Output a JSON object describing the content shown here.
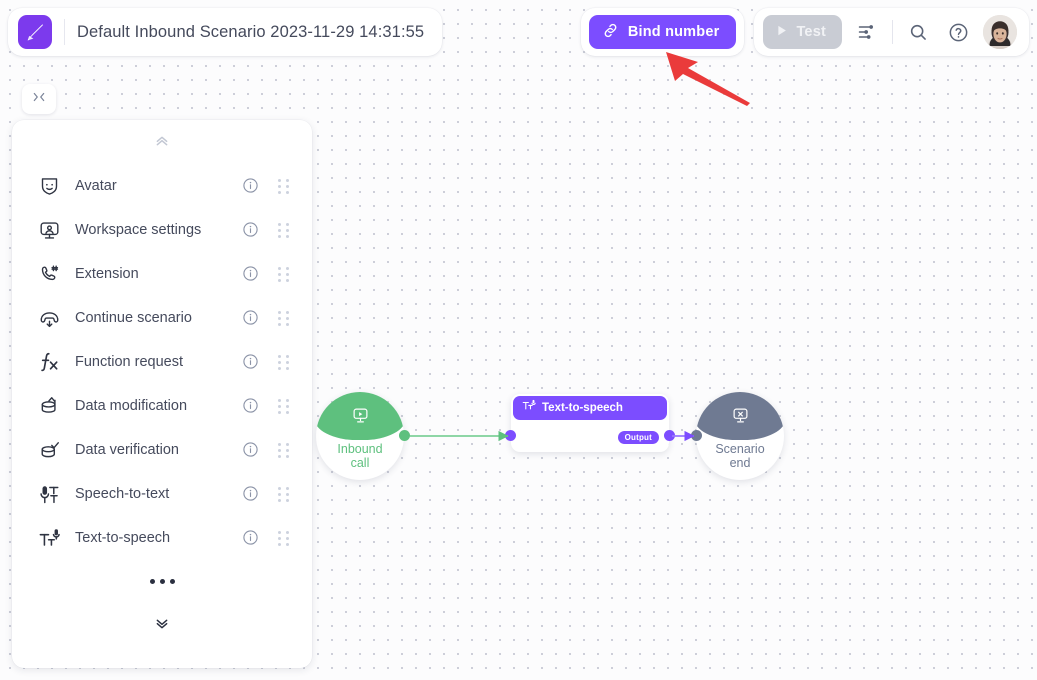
{
  "header": {
    "app_logo_icon": "pen-square-logo",
    "scenario_title": "Default Inbound Scenario 2023-11-29 14:31:55",
    "bind_number_label": "Bind number",
    "bind_number_icon": "link-chain-icon",
    "bind_number_color": "#7c4dff",
    "test_label": "Test",
    "test_icon": "play-icon",
    "test_disabled_color": "#c9ccd4",
    "settings_icon": "sliders-icon",
    "search_icon": "search-icon",
    "help_icon": "help-circle-icon",
    "avatar_icon": "user-avatar"
  },
  "canvas": {
    "collapse_button_icon": "collapse-horizontal-icon"
  },
  "sidebar": {
    "collapse_up_icon": "chevron-double-up-icon",
    "collapse_down_icon": "chevron-double-down-icon",
    "more_icon": "ellipsis-icon",
    "info_icon": "info-circle-icon",
    "drag_icon": "drag-grip-icon",
    "items": [
      {
        "label": "Avatar",
        "icon": "avatar-mask-icon"
      },
      {
        "label": "Workspace settings",
        "icon": "workspace-person-icon"
      },
      {
        "label": "Extension",
        "icon": "phone-hash-icon"
      },
      {
        "label": "Continue scenario",
        "icon": "phone-down-arrow-icon"
      },
      {
        "label": "Function request",
        "icon": "fx-function-icon"
      },
      {
        "label": "Data modification",
        "icon": "database-edit-icon"
      },
      {
        "label": "Data verification",
        "icon": "database-check-icon"
      },
      {
        "label": "Speech-to-text",
        "icon": "mic-to-text-icon"
      },
      {
        "label": "Text-to-speech",
        "icon": "text-to-mic-icon"
      }
    ]
  },
  "flow": {
    "start_node": {
      "label_line1": "Inbound",
      "label_line2": "call",
      "icon": "inbound-call-icon",
      "color": "#5ec07e"
    },
    "tts_node": {
      "title": "Text-to-speech",
      "icon": "text-to-mic-icon",
      "output_badge": "Output",
      "color": "#7c4dff"
    },
    "end_node": {
      "label_line1": "Scenario",
      "label_line2": "end",
      "icon": "scenario-end-icon",
      "color": "#6f7a92"
    },
    "edge_start_color": "#5ec07e",
    "edge_output_color": "#7c4dff"
  },
  "annotation": {
    "arrow_color": "#ea3b3b",
    "arrow_target": "bind-number-button"
  }
}
